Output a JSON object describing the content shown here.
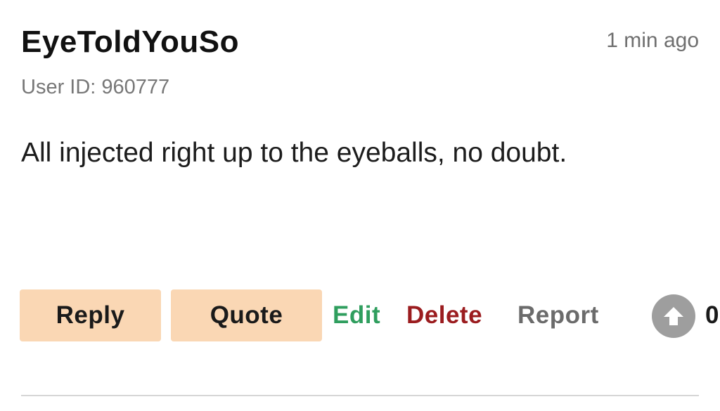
{
  "comment": {
    "username": "EyeToldYouSo",
    "timestamp": "1 min ago",
    "user_id_label": "User ID: 960777",
    "body": "All injected right up to the eyeballs, no doubt."
  },
  "actions": {
    "reply_label": "Reply",
    "quote_label": "Quote",
    "edit_label": "Edit",
    "delete_label": "Delete",
    "report_label": "Report",
    "upvote_icon": "arrow-up-icon",
    "vote_count": "0"
  },
  "colors": {
    "button_bg": "#fad7b4",
    "edit": "#2f9e5e",
    "delete": "#9b1c1f",
    "report": "#6b6b6b",
    "upvote_bg": "#9e9e9e"
  }
}
